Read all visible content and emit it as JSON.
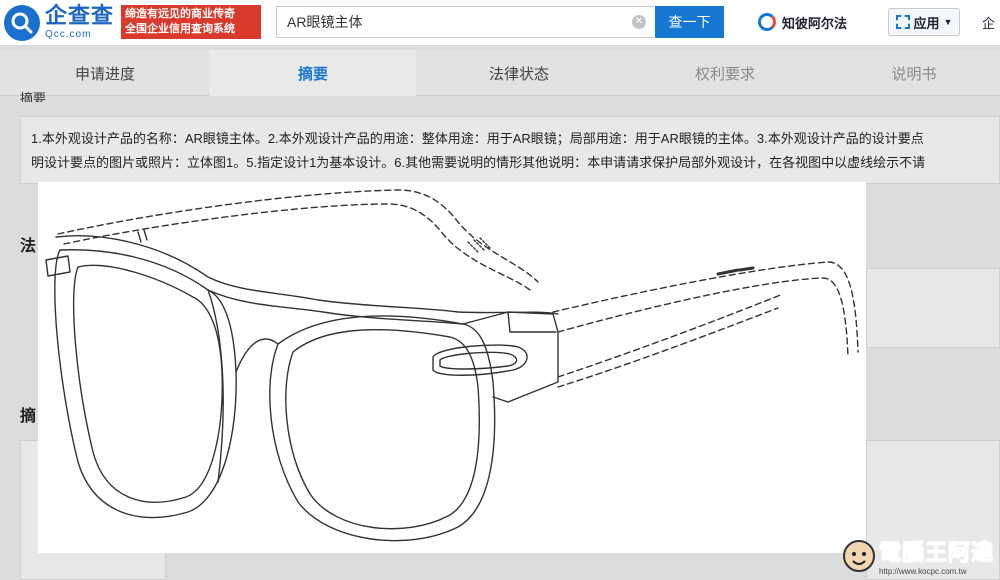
{
  "header": {
    "logo_name": "企查查",
    "logo_sub": "Qcc.com",
    "slogan_line1": "缔造有远见的商业传奇",
    "slogan_line2": "全国企业信用查询系统",
    "search_value": "AR眼镜主体",
    "search_button": "查一下",
    "zhibi_label": "知彼阿尔法",
    "app_label": "应用",
    "enterprise_label": "企"
  },
  "tabs": [
    {
      "label": "申请进度"
    },
    {
      "label": "摘要"
    },
    {
      "label": "法律状态"
    },
    {
      "label": "权利要求"
    },
    {
      "label": "说明书"
    }
  ],
  "content": {
    "clipped_label": "摘要",
    "abstract_line1": "1.本外观设计产品的名称：AR眼镜主体。2.本外观设计产品的用途：整体用途：用于AR眼镜；局部用途：用于AR眼镜的主体。3.本外观设计产品的设计要点",
    "abstract_line2": "明设计要点的图片或照片：立体图1。5.指定设计1为基本设计。6.其他需要说明的情形其他说明：本申请请求保护局部外观设计，在各视图中以虚线绘示不请",
    "section_1_partial": "法",
    "section_2_partial": "摘"
  },
  "watermark": {
    "title": "電腦王阿達",
    "url": "http://www.kocpc.com.tw"
  }
}
